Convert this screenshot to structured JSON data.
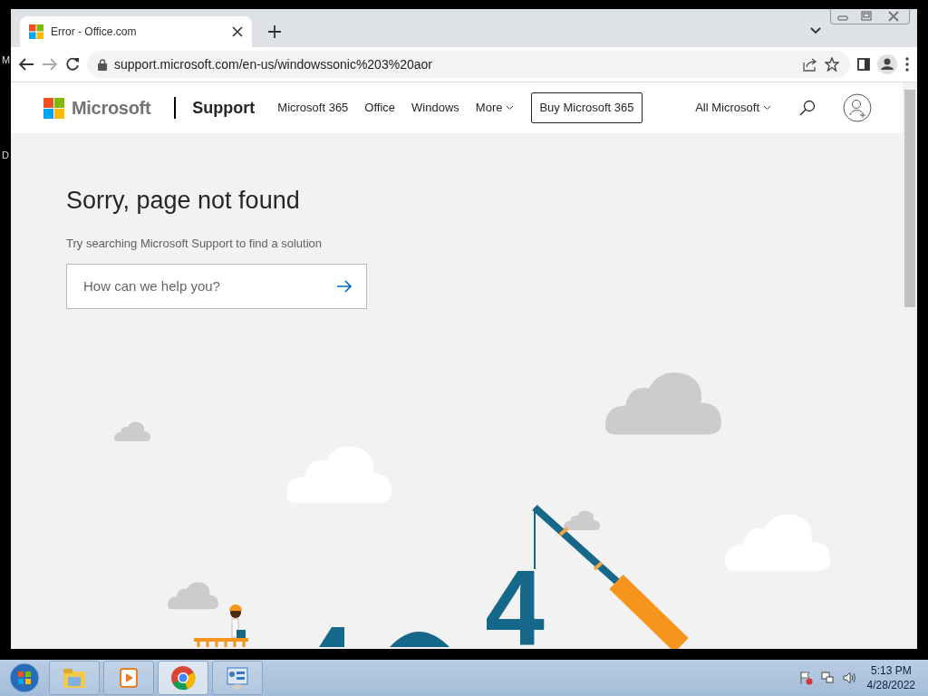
{
  "desktop": {
    "labels": [
      "M",
      "D"
    ]
  },
  "browser": {
    "tab": {
      "title": "Error - Office.com",
      "selected": true
    },
    "address": "support.microsoft.com/en-us/windowssonic%203%20aor"
  },
  "site": {
    "brand": "Microsoft",
    "section": "Support",
    "nav": [
      {
        "label": "Microsoft 365",
        "dropdown": false
      },
      {
        "label": "Office",
        "dropdown": false
      },
      {
        "label": "Windows",
        "dropdown": false
      },
      {
        "label": "More",
        "dropdown": true
      }
    ],
    "buy_button": "Buy Microsoft 365",
    "all_menu": "All Microsoft"
  },
  "error": {
    "heading": "Sorry, page not found",
    "subtext": "Try searching Microsoft Support to find a solution",
    "search": {
      "placeholder": "How can we help you?"
    },
    "illustration_digit": "4"
  },
  "taskbar": {
    "apps": [
      {
        "kind": "folder",
        "selected": false
      },
      {
        "kind": "media",
        "selected": false
      },
      {
        "kind": "chrome",
        "selected": true
      },
      {
        "kind": "panel",
        "selected": false
      }
    ],
    "time": "5:13 PM",
    "date": "4/28/2022"
  }
}
